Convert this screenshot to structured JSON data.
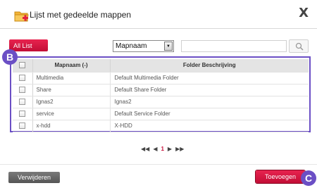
{
  "dialog": {
    "title": "Lijst met gedeelde mappen",
    "close_label": "X"
  },
  "toolbar": {
    "all_list_label": "All List",
    "select_value": "Mapnaam",
    "search_placeholder": ""
  },
  "table": {
    "headers": [
      "Mapnaam (-)",
      "Folder Beschrijving"
    ],
    "rows": [
      {
        "name": "Multimedia",
        "description": "Default Multimedia Folder"
      },
      {
        "name": "Share",
        "description": "Default Share Folder"
      },
      {
        "name": "Ignas2",
        "description": "Ignas2"
      },
      {
        "name": "service",
        "description": "Default Service Folder"
      },
      {
        "name": "x-hdd",
        "description": "X-HDD"
      }
    ]
  },
  "pagination": {
    "first": "◀◀",
    "prev": "◀",
    "current": "1",
    "next": "▶",
    "last": "▶▶"
  },
  "actions": {
    "delete_label": "Verwijderen",
    "add_label": "Toevoegen"
  },
  "annotations": {
    "b": "B",
    "c": "C"
  },
  "colors": {
    "accent_red": "#d0153f",
    "annotation_purple": "#6b4fc5"
  }
}
